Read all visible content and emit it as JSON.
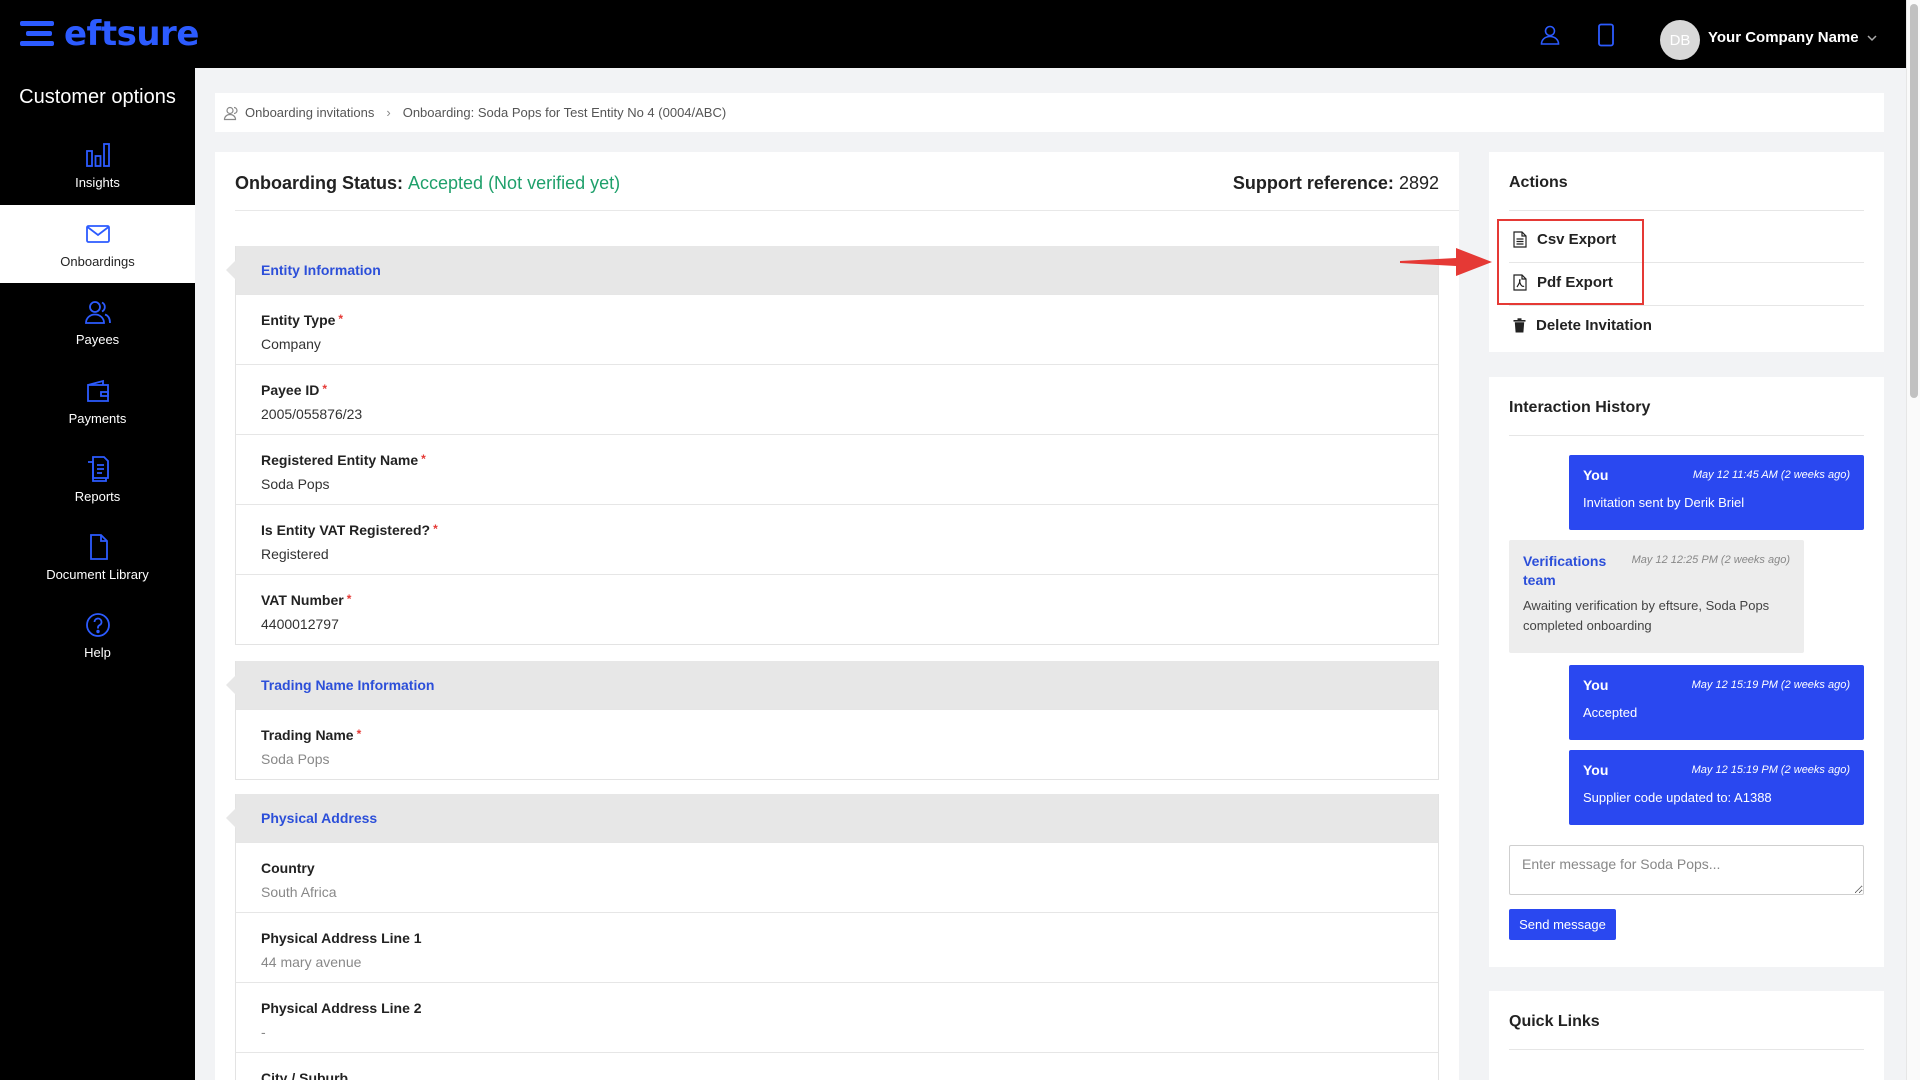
{
  "brand": {
    "name": "eftsure",
    "accent": "#2c5bff"
  },
  "header": {
    "avatar_initials": "DB",
    "company_name": "Your Company Name",
    "icons": [
      "user-icon",
      "mobile-icon",
      "chevron-down-icon"
    ]
  },
  "sidebar": {
    "title": "Customer options",
    "items": [
      {
        "label": "Insights",
        "icon": "bar-chart-icon"
      },
      {
        "label": "Onboardings",
        "icon": "envelope-icon",
        "active": true
      },
      {
        "label": "Payees",
        "icon": "users-icon"
      },
      {
        "label": "Payments",
        "icon": "wallet-icon"
      },
      {
        "label": "Reports",
        "icon": "reports-icon"
      },
      {
        "label": "Document Library",
        "icon": "document-icon"
      },
      {
        "label": "Help",
        "icon": "help-icon"
      }
    ]
  },
  "breadcrumb": {
    "items": [
      "Onboarding invitations",
      "Onboarding: Soda Pops for Test Entity No 4 (0004/ABC)"
    ]
  },
  "status": {
    "label": "Onboarding Status:",
    "value": "Accepted (Not verified yet)",
    "support_label": "Support reference:",
    "support_value": "2892",
    "status_color": "#1fa06b"
  },
  "sections": [
    {
      "title": "Entity Information",
      "fields": [
        {
          "label": "Entity Type",
          "value": "Company",
          "required": true
        },
        {
          "label": "Payee ID",
          "value": "2005/055876/23",
          "required": true
        },
        {
          "label": "Registered Entity Name",
          "value": "Soda Pops",
          "required": true
        },
        {
          "label": "Is Entity VAT Registered?",
          "value": "Registered",
          "required": true
        },
        {
          "label": "VAT Number",
          "value": "4400012797",
          "required": true
        }
      ]
    },
    {
      "title": "Trading Name Information",
      "fields": [
        {
          "label": "Trading Name",
          "value": "Soda Pops",
          "required": true
        }
      ]
    },
    {
      "title": "Physical Address",
      "fields": [
        {
          "label": "Country",
          "value": "South Africa"
        },
        {
          "label": "Physical Address Line 1",
          "value": "44 mary avenue"
        },
        {
          "label": "Physical Address Line 2",
          "value": "-"
        },
        {
          "label": "City / Suburb",
          "value": ""
        }
      ]
    }
  ],
  "actions": {
    "title": "Actions",
    "items": [
      {
        "label": "Csv Export",
        "icon": "file-text-icon"
      },
      {
        "label": "Pdf Export",
        "icon": "file-pdf-icon"
      },
      {
        "label": "Delete Invitation",
        "icon": "trash-icon"
      }
    ]
  },
  "history": {
    "title": "Interaction History",
    "messages": [
      {
        "author": "You",
        "time": "May 12 11:45 AM (2 weeks ago)",
        "text": "Invitation sent by Derik Briel",
        "type": "you"
      },
      {
        "author": "Verifications team",
        "time": "May 12 12:25 PM (2 weeks ago)",
        "text": "Awaiting verification by eftsure, Soda Pops completed onboarding",
        "type": "team"
      },
      {
        "author": "You",
        "time": "May 12 15:19 PM (2 weeks ago)",
        "text": "Accepted",
        "type": "you"
      },
      {
        "author": "You",
        "time": "May 12 15:19 PM (2 weeks ago)",
        "text": "Supplier code updated to: A1388",
        "type": "you"
      }
    ],
    "input_placeholder": "Enter message for Soda Pops...",
    "send_label": "Send message"
  },
  "quick_links": {
    "title": "Quick Links"
  }
}
